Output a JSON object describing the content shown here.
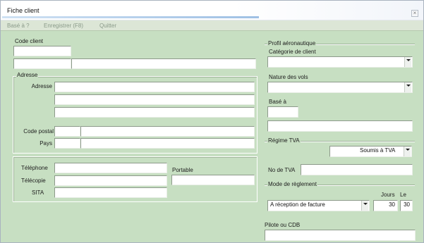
{
  "window": {
    "title": "Fiche client",
    "close_glyph": "×"
  },
  "menu": [
    {
      "label": "Basé à ?"
    },
    {
      "label": "Enregistrer (F8)"
    },
    {
      "label": "Quitter"
    }
  ],
  "client": {
    "code_label": "Code client",
    "code_value": "",
    "sub_value": "",
    "name_value": ""
  },
  "adresse": {
    "legend": "Adresse",
    "adresse_label": "Adresse",
    "line1": "",
    "line2": "",
    "line3": "",
    "code_postal_label": "Code postal",
    "code_postal": "",
    "ville": "",
    "pays_label": "Pays",
    "pays_code": "",
    "pays_name": ""
  },
  "contact": {
    "telephone_label": "Téléphone",
    "telephone": "",
    "telecopie_label": "Télécopie",
    "telecopie": "",
    "sita_label": "SITA",
    "sita": "",
    "portable_label": "Portable",
    "portable": ""
  },
  "profil": {
    "legend": "Profil aéronautique",
    "categorie_label": "Catégorie de client",
    "categorie_value": "",
    "nature_label": "Nature des vols",
    "nature_value": "",
    "base_label": "Basé à",
    "base_code": "",
    "base_name": ""
  },
  "tva": {
    "legend": "Régime TVA",
    "regime_value": "Soumis à TVA",
    "no_label": "No de TVA",
    "no_value": ""
  },
  "reglement": {
    "legend": "Mode de règlement",
    "jours_label": "Jours",
    "le_label": "Le",
    "mode_value": "A réception de facture",
    "jours_value": "30",
    "le_value": "30"
  },
  "pilote": {
    "label": "Pilote ou CDB",
    "value": ""
  },
  "colors": {
    "background": "#c7dfc2",
    "input": "#ffffff",
    "menu_text": "#8a9a89"
  },
  "icons": {
    "combo": "chevron-down-icon",
    "close": "close-icon"
  }
}
